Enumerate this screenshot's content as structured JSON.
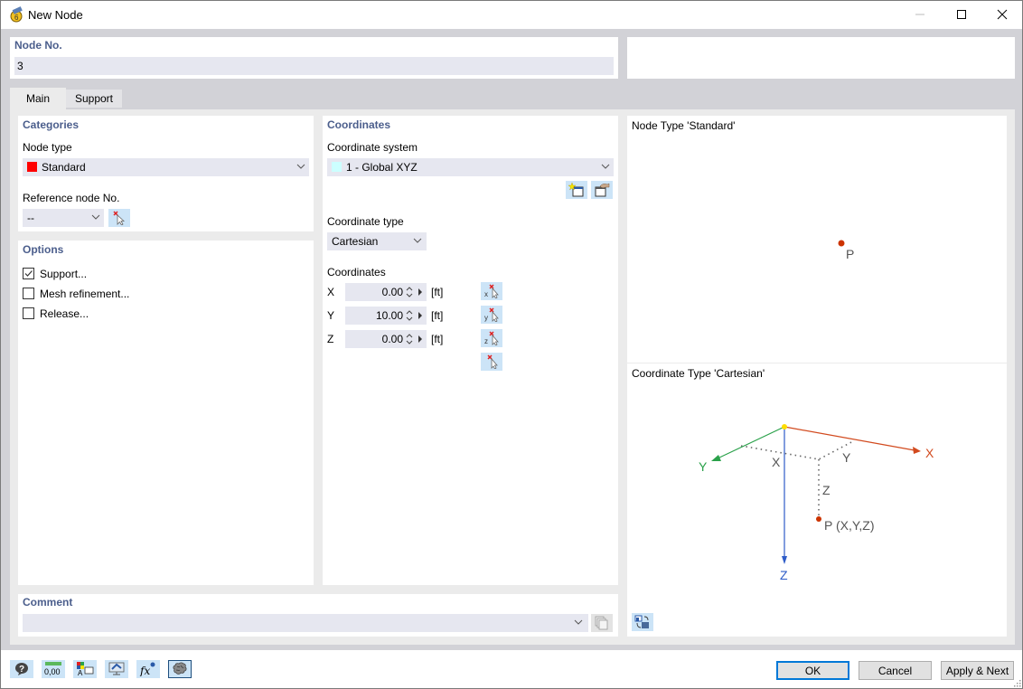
{
  "window": {
    "title": "New Node",
    "controls": {
      "minimize": "minimize",
      "maximize": "maximize",
      "close": "close"
    }
  },
  "header": {
    "node_no_label": "Node No.",
    "node_no_value": "3"
  },
  "tabs": [
    {
      "label": "Main",
      "active": true
    },
    {
      "label": "Support",
      "active": false
    }
  ],
  "categories": {
    "title": "Categories",
    "node_type_label": "Node type",
    "node_type_value": "Standard",
    "node_type_color": "#ff0000",
    "reference_node_label": "Reference node No.",
    "reference_node_value": "--"
  },
  "options": {
    "title": "Options",
    "items": [
      {
        "label": "Support...",
        "checked": true
      },
      {
        "label": "Mesh refinement...",
        "checked": false
      },
      {
        "label": "Release...",
        "checked": false
      }
    ]
  },
  "coordinates": {
    "title": "Coordinates",
    "system_label": "Coordinate system",
    "system_value": "1 - Global XYZ",
    "system_color": "#ccffff",
    "type_label": "Coordinate type",
    "type_value": "Cartesian",
    "coords_label": "Coordinates",
    "rows": [
      {
        "axis": "X",
        "value": "0.00",
        "unit": "[ft]"
      },
      {
        "axis": "Y",
        "value": "10.00",
        "unit": "[ft]"
      },
      {
        "axis": "Z",
        "value": "0.00",
        "unit": "[ft]"
      }
    ]
  },
  "preview": {
    "node_type_title": "Node Type 'Standard'",
    "node_point_label": "P",
    "coord_type_title": "Coordinate Type 'Cartesian'",
    "axes": {
      "x": "X",
      "y": "Y",
      "z": "Z"
    },
    "dim_labels": {
      "x": "X",
      "y": "Y",
      "z": "Z"
    },
    "point_label": "P (X,Y,Z)",
    "colors": {
      "x": "#d24a1e",
      "y": "#2aa14a",
      "z": "#2e5cc8",
      "point": "#cc3300",
      "origin": "#ffdd00"
    }
  },
  "comment": {
    "title": "Comment",
    "value": ""
  },
  "footer": {
    "ok": "OK",
    "cancel": "Cancel",
    "apply_next": "Apply & Next",
    "units_icon_text": "0,00"
  }
}
